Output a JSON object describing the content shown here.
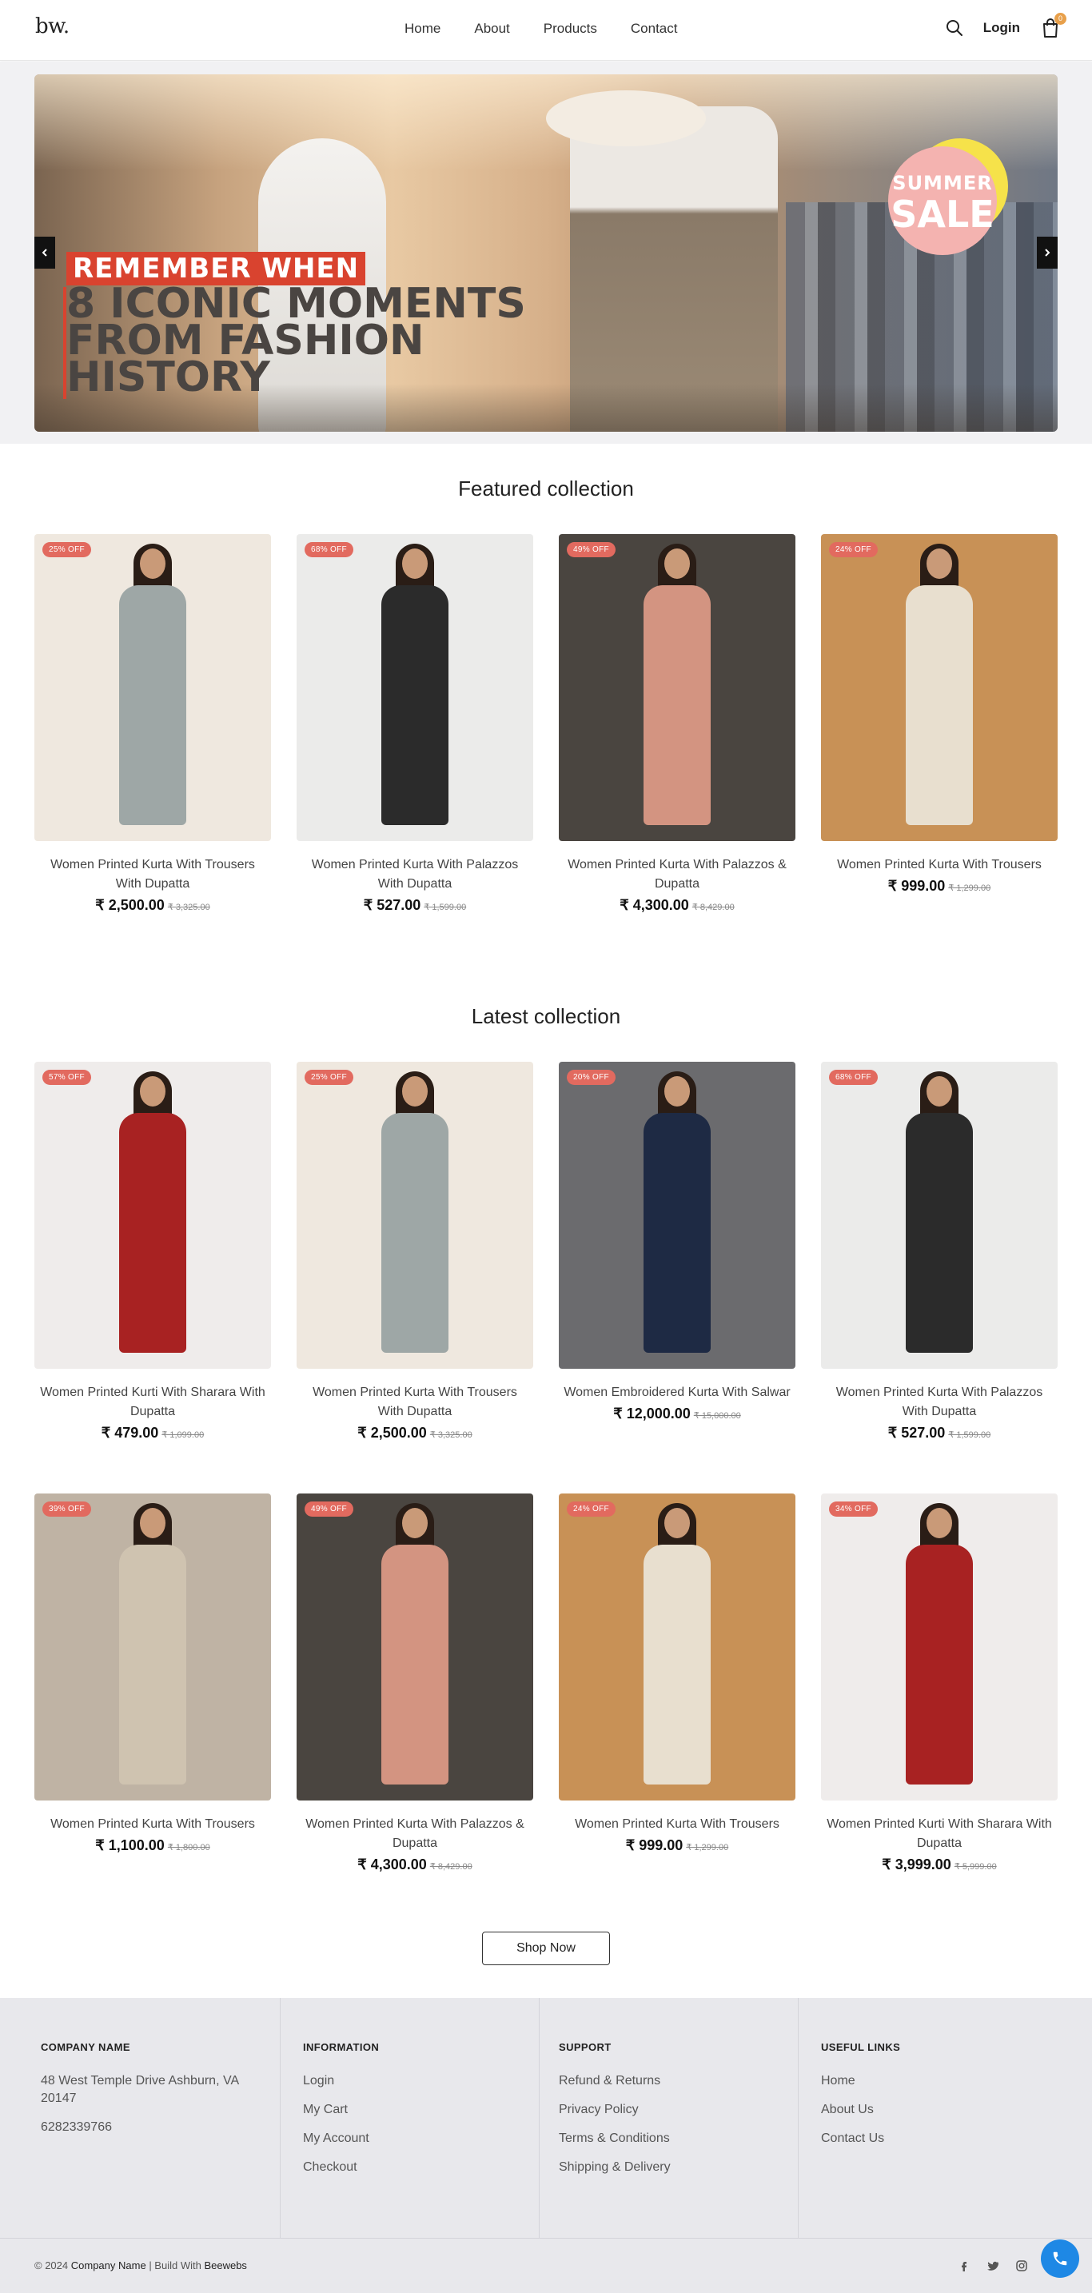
{
  "header": {
    "logo": "bw.",
    "nav": [
      "Home",
      "About",
      "Products",
      "Contact"
    ],
    "login": "Login",
    "cart_count": "0"
  },
  "banner": {
    "tag": "REMEMBER WHEN",
    "headline_lines": [
      "8 ICONIC MOMENTS",
      "FROM FASHION",
      "HISTORY"
    ],
    "sale_line1": "SUMMER",
    "sale_line2": "SALE"
  },
  "featured": {
    "title": "Featured collection",
    "products": [
      {
        "badge": "25% OFF",
        "name": "Women Printed Kurta With Trousers With Dupatta",
        "price": "₹ 2,500.00",
        "old_price": "₹ 3,325.00",
        "dress": "#9ea7a6",
        "bg": "#efe8df"
      },
      {
        "badge": "68% OFF",
        "name": "Women Printed Kurta With Palazzos With Dupatta",
        "price": "₹ 527.00",
        "old_price": "₹ 1,599.00",
        "dress": "#2b2b2b",
        "bg": "#ebebea"
      },
      {
        "badge": "49% OFF",
        "name": "Women Printed Kurta With Palazzos & Dupatta",
        "price": "₹ 4,300.00",
        "old_price": "₹ 8,429.00",
        "dress": "#d39481",
        "bg": "#4a4540"
      },
      {
        "badge": "24% OFF",
        "name": "Women Printed Kurta With Trousers",
        "price": "₹ 999.00",
        "old_price": "₹ 1,299.00",
        "dress": "#e8dfcf",
        "bg": "#c89156"
      }
    ]
  },
  "latest": {
    "title": "Latest collection",
    "products": [
      {
        "badge": "57% OFF",
        "name": "Women Printed Kurti With Sharara With Dupatta",
        "price": "₹ 479.00",
        "old_price": "₹ 1,099.00",
        "dress": "#a82222",
        "bg": "#efeceb"
      },
      {
        "badge": "25% OFF",
        "name": "Women Printed Kurta With Trousers With Dupatta",
        "price": "₹ 2,500.00",
        "old_price": "₹ 3,325.00",
        "dress": "#9ea7a6",
        "bg": "#efe8df"
      },
      {
        "badge": "20% OFF",
        "name": "Women Embroidered Kurta With Salwar",
        "price": "₹ 12,000.00",
        "old_price": "₹ 15,000.00",
        "dress": "#1e2a44",
        "bg": "#6b6b6e"
      },
      {
        "badge": "68% OFF",
        "name": "Women Printed Kurta With Palazzos With Dupatta",
        "price": "₹ 527.00",
        "old_price": "₹ 1,599.00",
        "dress": "#2b2b2b",
        "bg": "#ebebea"
      },
      {
        "badge": "39% OFF",
        "name": "Women Printed Kurta With Trousers",
        "price": "₹ 1,100.00",
        "old_price": "₹ 1,800.00",
        "dress": "#cfc3b0",
        "bg": "#bfb3a4"
      },
      {
        "badge": "49% OFF",
        "name": "Women Printed Kurta With Palazzos & Dupatta",
        "price": "₹ 4,300.00",
        "old_price": "₹ 8,429.00",
        "dress": "#d39481",
        "bg": "#4a4540"
      },
      {
        "badge": "24% OFF",
        "name": "Women Printed Kurta With Trousers",
        "price": "₹ 999.00",
        "old_price": "₹ 1,299.00",
        "dress": "#e8dfcf",
        "bg": "#c89156"
      },
      {
        "badge": "34% OFF",
        "name": "Women Printed Kurti With Sharara With Dupatta",
        "price": "₹ 3,999.00",
        "old_price": "₹ 5,999.00",
        "dress": "#a82222",
        "bg": "#efeceb"
      }
    ]
  },
  "shop_now": "Shop Now",
  "footer": {
    "company": {
      "title": "COMPANY NAME",
      "address": "48 West Temple Drive Ashburn, VA 20147",
      "phone": "6282339766"
    },
    "information": {
      "title": "INFORMATION",
      "links": [
        "Login",
        "My Cart",
        "My Account",
        "Checkout"
      ]
    },
    "support": {
      "title": "SUPPORT",
      "links": [
        "Refund & Returns",
        "Privacy Policy",
        "Terms & Conditions",
        "Shipping & Delivery"
      ]
    },
    "useful": {
      "title": "USEFUL LINKS",
      "links": [
        "Home",
        "About Us",
        "Contact Us"
      ]
    },
    "copyright_prefix": "© 2024",
    "copyright_company": "Company Name",
    "copyright_mid": "| Build With",
    "copyright_builder": "Beewebs"
  }
}
